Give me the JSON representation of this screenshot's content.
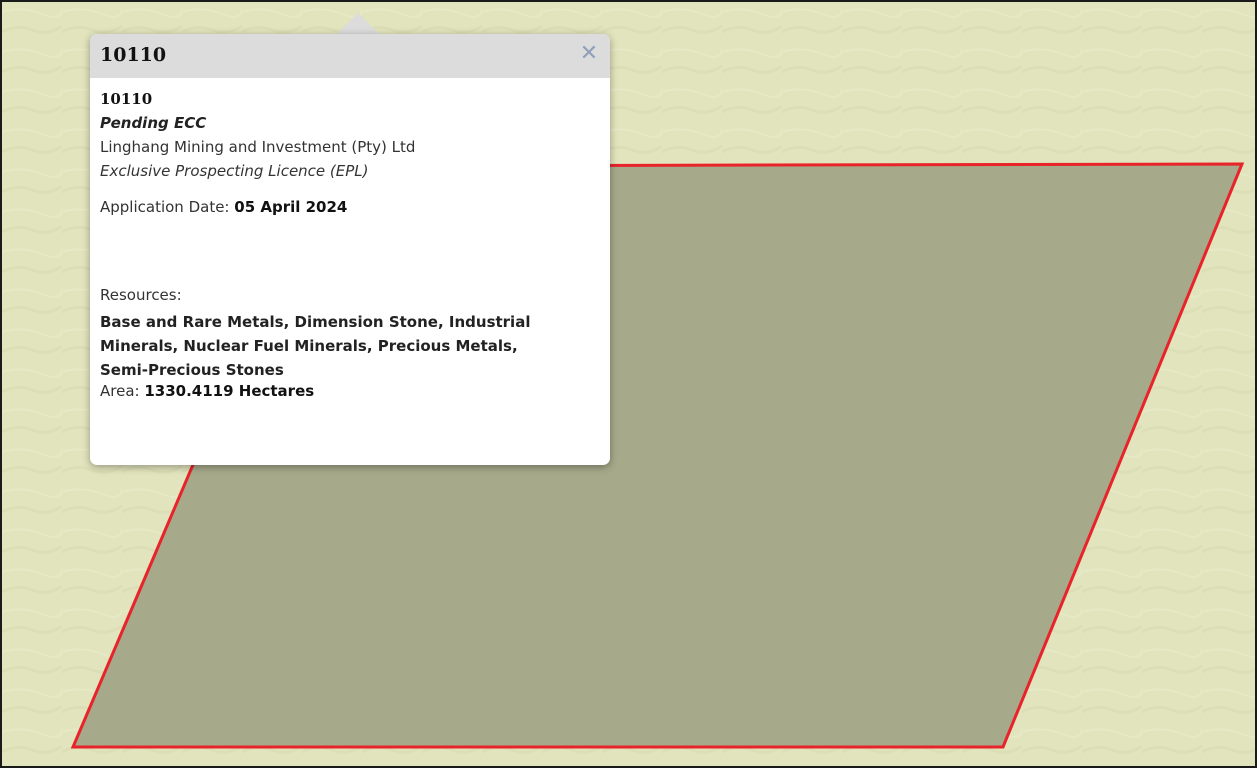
{
  "map": {
    "background_color": "#e2e4bd",
    "parcel": {
      "fill_color": "#a6a98a",
      "outline_color": "#e8232a"
    }
  },
  "popup": {
    "title": "10110",
    "close_icon": "close-icon",
    "close_glyph": "✕",
    "parcel_id": "10110",
    "status": "Pending ECC",
    "holder": "Linghang Mining and Investment (Pty) Ltd",
    "licence_type": "Exclusive Prospecting Licence (EPL)",
    "application_date_label": "Application Date: ",
    "application_date": "05 April 2024",
    "resources_label": "Resources:",
    "resources": "Base and Rare Metals, Dimension Stone, Industrial Minerals, Nuclear Fuel Minerals, Precious Metals, Semi-Precious Stones",
    "area_label": "Area: ",
    "area": "1330.4119 Hectares"
  }
}
